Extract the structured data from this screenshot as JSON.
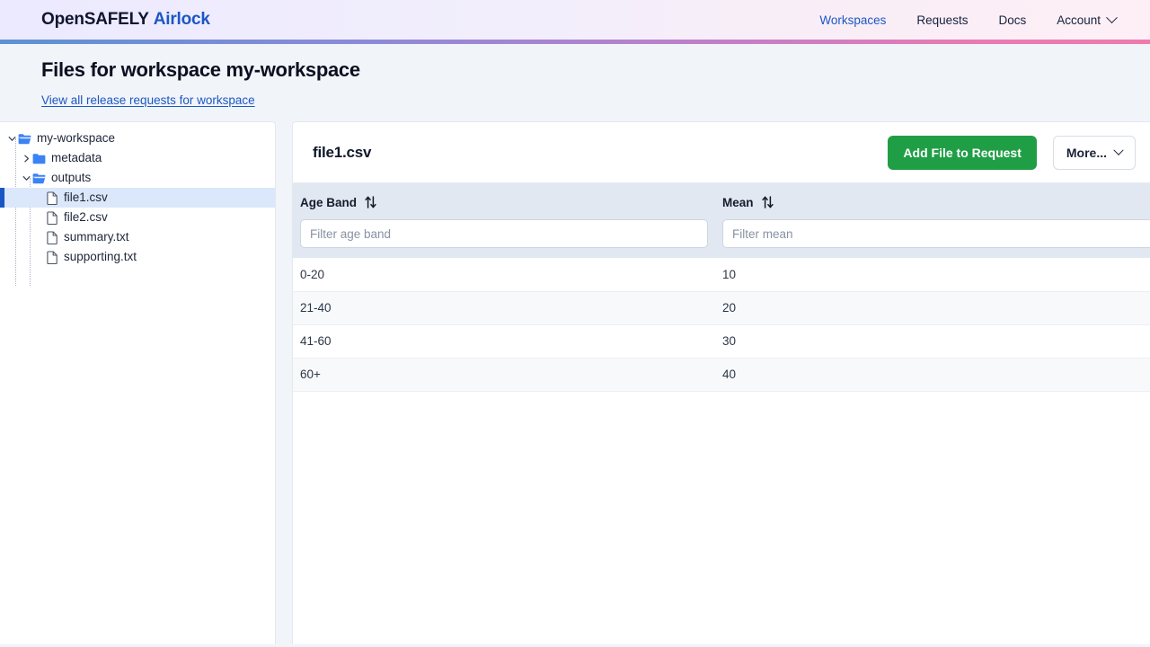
{
  "nav": {
    "brand_first": "OpenSAFELY",
    "brand_second": "Airlock",
    "links": [
      {
        "label": "Workspaces",
        "active": true
      },
      {
        "label": "Requests",
        "active": false
      },
      {
        "label": "Docs",
        "active": false
      },
      {
        "label": "Account",
        "active": false
      }
    ],
    "accent_blue": "#1b57c4",
    "gradient_start": "#5b92d4",
    "gradient_end": "#ed7bae"
  },
  "page": {
    "title": "Files for workspace my-workspace",
    "sub_link": "View all release requests for workspace"
  },
  "sidebar": {
    "tree": [
      {
        "label": "my-workspace",
        "type": "folder-open",
        "depth": 0,
        "chevron": "expanded",
        "selected": false
      },
      {
        "label": "metadata",
        "type": "folder-closed",
        "depth": 1,
        "chevron": "collapsed",
        "selected": false
      },
      {
        "label": "outputs",
        "type": "folder-open",
        "depth": 1,
        "chevron": "expanded",
        "selected": false
      },
      {
        "label": "file1.csv",
        "type": "file",
        "depth": 2,
        "chevron": "none",
        "selected": true
      },
      {
        "label": "file2.csv",
        "type": "file",
        "depth": 2,
        "chevron": "none",
        "selected": false
      },
      {
        "label": "summary.txt",
        "type": "file",
        "depth": 2,
        "chevron": "none",
        "selected": false
      },
      {
        "label": "supporting.txt",
        "type": "file",
        "depth": 2,
        "chevron": "none",
        "selected": false
      }
    ],
    "folder_color": "#3b82f6",
    "selected_bg": "#dbe8fb"
  },
  "content": {
    "file_title": "file1.csv",
    "add_button": "Add File to Request",
    "more_button": "More...",
    "add_button_color": "#1f9e46"
  },
  "table": {
    "columns": [
      {
        "header": "Age Band",
        "filter_placeholder": "Filter age band",
        "filter_value": "",
        "sortable": true
      },
      {
        "header": "Mean",
        "filter_placeholder": "Filter mean",
        "filter_value": "",
        "sortable": true
      }
    ],
    "rows": [
      [
        "0-20",
        "10"
      ],
      [
        "21-40",
        "20"
      ],
      [
        "41-60",
        "30"
      ],
      [
        "60+",
        "40"
      ]
    ]
  }
}
